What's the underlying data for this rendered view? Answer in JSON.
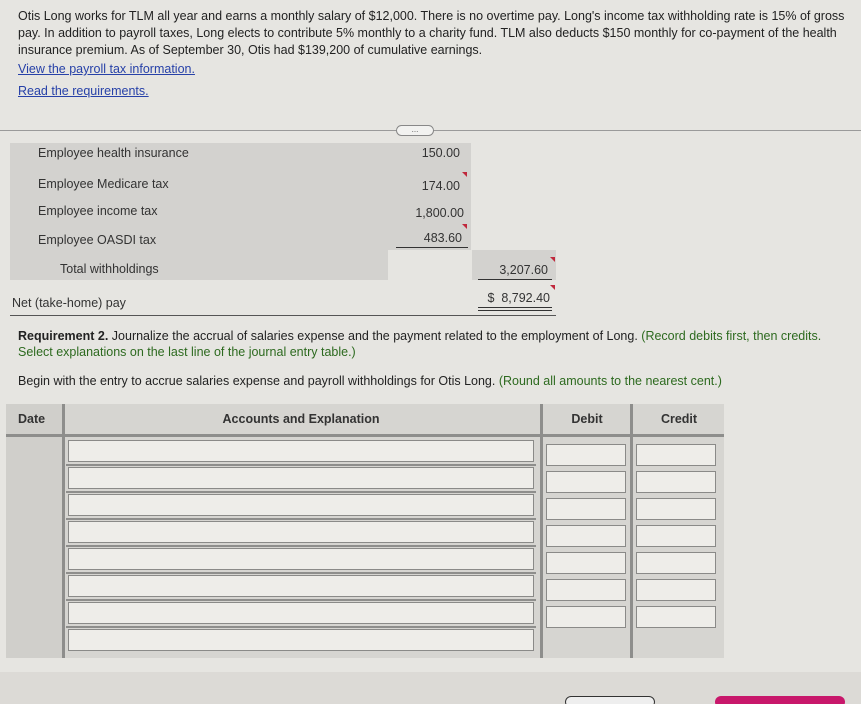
{
  "problem": {
    "text": "Otis Long works for TLM all year and earns a monthly salary of $12,000. There is no overtime pay. Long's income tax withholding rate is 15% of gross pay. In addition to payroll taxes, Long elects to contribute 5% monthly to a charity fund. TLM also deducts $150 monthly for co-payment of the health insurance premium. As of September 30, Otis had $139,200 of cumulative earnings."
  },
  "links": {
    "payroll_tax": "View the payroll tax information.",
    "requirements": "Read the requirements."
  },
  "ellipsis": "...",
  "withholdings": {
    "rows": [
      {
        "label": "Employee health insurance",
        "amount": "150.00"
      },
      {
        "label": "Employee Medicare tax",
        "amount": "174.00"
      },
      {
        "label": "Employee income tax",
        "amount": "1,800.00"
      },
      {
        "label": "Employee OASDI tax",
        "amount": "483.60"
      }
    ],
    "total_label": "Total withholdings",
    "total_amount": "3,207.60",
    "net_label": "Net (take-home) pay",
    "net_amount": "$  8,792.40"
  },
  "requirement": {
    "bold": "Requirement 2.",
    "text": " Journalize the accrual of salaries expense and the payment related to the employment of Long.",
    "green": " (Record debits first, then credits. Select explanations on the last line of the journal entry table.)"
  },
  "begin": {
    "text": "Begin with the entry to accrue salaries expense and payroll withholdings for Otis Long.",
    "green": " (Round all amounts to the nearest cent.)"
  },
  "journal": {
    "headers": {
      "date": "Date",
      "accounts": "Accounts and Explanation",
      "debit": "Debit",
      "credit": "Credit"
    },
    "rows": [
      {
        "account": "",
        "debit": "",
        "credit": ""
      },
      {
        "account": "",
        "debit": "",
        "credit": ""
      },
      {
        "account": "",
        "debit": "",
        "credit": ""
      },
      {
        "account": "",
        "debit": "",
        "credit": ""
      },
      {
        "account": "",
        "debit": "",
        "credit": ""
      },
      {
        "account": "",
        "debit": "",
        "credit": ""
      },
      {
        "account": "",
        "debit": "",
        "credit": ""
      }
    ],
    "explanation": ""
  },
  "colors": {
    "link": "#2741a8",
    "instruction_green": "#2d6a1f",
    "accent": "#c8176b",
    "tick_red": "#c0283c"
  }
}
